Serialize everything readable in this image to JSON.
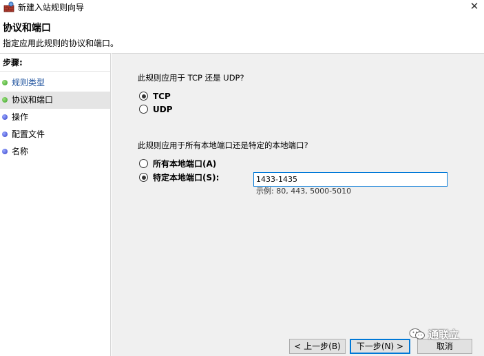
{
  "window": {
    "title": "新建入站规则向导",
    "close_symbol": "✕"
  },
  "header": {
    "title": "协议和端口",
    "subtitle": "指定应用此规则的协议和端口。"
  },
  "sidebar": {
    "heading": "步骤:",
    "items": [
      {
        "label": "规则类型",
        "state": "done"
      },
      {
        "label": "协议和端口",
        "state": "current"
      },
      {
        "label": "操作",
        "state": "pending"
      },
      {
        "label": "配置文件",
        "state": "pending"
      },
      {
        "label": "名称",
        "state": "pending"
      }
    ]
  },
  "main": {
    "protocol_question": "此规则应用于 TCP 还是 UDP?",
    "protocol_options": [
      {
        "label": "TCP",
        "checked": true
      },
      {
        "label": "UDP",
        "checked": false
      }
    ],
    "port_question": "此规则应用于所有本地端口还是特定的本地端口?",
    "port_options": [
      {
        "label": "所有本地端口(A)",
        "checked": false
      },
      {
        "label": "特定本地端口(S):",
        "checked": true
      }
    ],
    "port_value": "1433-1435",
    "port_example": "示例: 80, 443, 5000-5010"
  },
  "buttons": {
    "back": "< 上一步(B)",
    "next": "下一步(N) >",
    "cancel": "取消"
  },
  "watermark": {
    "text": "通联立"
  },
  "colors": {
    "done_dot": "#3aa12a",
    "pending_dot": "#3340c8",
    "focus_border": "#0078d7",
    "panel_bg": "#f0f0f0"
  }
}
